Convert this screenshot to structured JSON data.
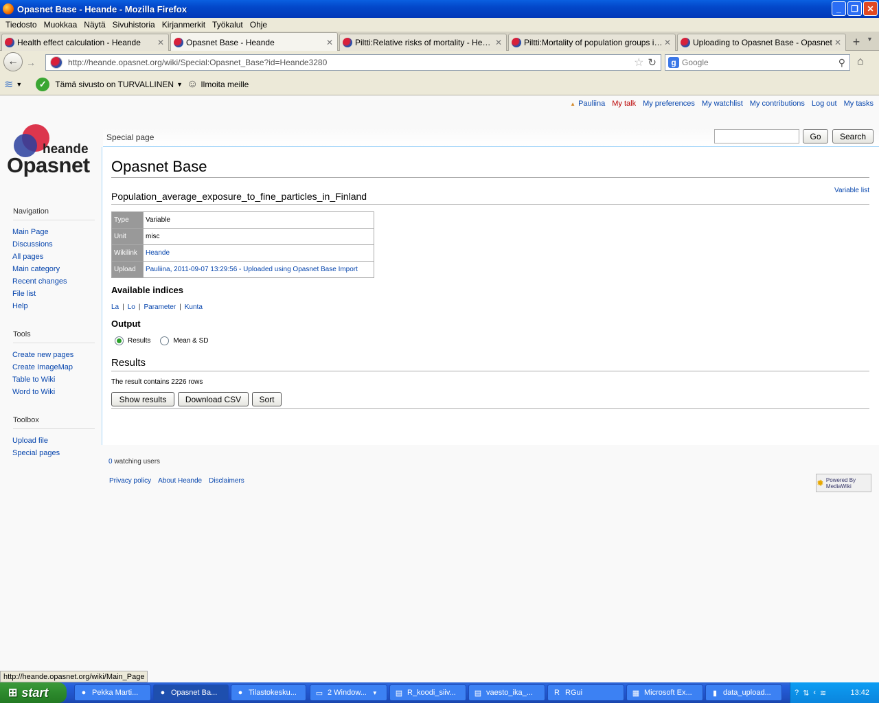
{
  "window": {
    "title": "Opasnet Base - Heande - Mozilla Firefox",
    "buttons": {
      "minimize": "_",
      "maximize": "❐",
      "close": "✕"
    }
  },
  "menubar": [
    "Tiedosto",
    "Muokkaa",
    "Näytä",
    "Sivuhistoria",
    "Kirjanmerkit",
    "Työkalut",
    "Ohje"
  ],
  "tabs": [
    {
      "label": "Health effect calculation - Heande",
      "active": false
    },
    {
      "label": "Opasnet Base - Heande",
      "active": true
    },
    {
      "label": "Piltti:Relative risks of mortality - Heande",
      "active": false
    },
    {
      "label": "Piltti:Mortality of population groups in Fi...",
      "active": false
    },
    {
      "label": "Uploading to Opasnet Base - Opasnet",
      "active": false
    }
  ],
  "navbar": {
    "url": "http://heande.opasnet.org/wiki/Special:Opasnet_Base?id=Heande3280",
    "search_placeholder": "Google"
  },
  "exttoolbar": {
    "safe_text": "Tämä sivusto on TURVALLINEN",
    "report_text": "Ilmoita meille"
  },
  "personal": {
    "user": "Pauliina",
    "talk": "My talk",
    "preferences": "My preferences",
    "watchlist": "My watchlist",
    "contributions": "My contributions",
    "logout": "Log out",
    "tasks": "My tasks"
  },
  "logo": {
    "top": "heande",
    "bottom": "Opasnet"
  },
  "sidebar": {
    "navigation": {
      "title": "Navigation",
      "items": [
        "Main Page",
        "Discussions",
        "All pages",
        "Main category",
        "Recent changes",
        "File list",
        "Help"
      ]
    },
    "tools": {
      "title": "Tools",
      "items": [
        "Create new pages",
        "Create ImageMap",
        "Table to Wiki",
        "Word to Wiki"
      ]
    },
    "toolbox": {
      "title": "Toolbox",
      "items": [
        "Upload file",
        "Special pages"
      ]
    }
  },
  "header": {
    "tab_label": "Special page",
    "go_label": "Go",
    "search_label": "Search"
  },
  "main": {
    "title": "Opasnet Base",
    "variable_list": "Variable list",
    "variable_name": "Population_average_exposure_to_fine_particles_in_Finland",
    "meta": [
      {
        "key": "Type",
        "value": "Variable"
      },
      {
        "key": "Unit",
        "value": "misc"
      },
      {
        "key": "Wikilink",
        "value": "Heande"
      },
      {
        "key": "Upload",
        "value": "Pauliina, 2011-09-07 13:29:56 - Uploaded using Opasnet Base Import"
      }
    ],
    "indices_title": "Available indices",
    "indices": [
      "La",
      "Lo",
      "Parameter",
      "Kunta"
    ],
    "output_title": "Output",
    "output_options": [
      {
        "label": "Results",
        "selected": true
      },
      {
        "label": "Mean & SD",
        "selected": false
      }
    ],
    "results_title": "Results",
    "rows_text": "The result contains 2226 rows",
    "buttons": {
      "show": "Show results",
      "download": "Download CSV",
      "sort": "Sort"
    }
  },
  "footer": {
    "watch_count": "0",
    "watch_text": " watching users",
    "links": [
      "Privacy policy",
      "About Heande",
      "Disclaimers"
    ],
    "powered": "Powered By MediaWiki"
  },
  "statusbar": "http://heande.opasnet.org/wiki/Main_Page",
  "taskbar": {
    "start": "start",
    "tasks": [
      {
        "label": "Pekka Marti...",
        "icon": "firefox-icon",
        "active": false
      },
      {
        "label": "Opasnet Ba...",
        "icon": "firefox-icon",
        "active": true
      },
      {
        "label": "Tilastokesku...",
        "icon": "firefox-icon",
        "active": false
      },
      {
        "label": "2 Window...",
        "icon": "folder-icon",
        "active": false
      },
      {
        "label": "R_koodi_siiv...",
        "icon": "document-icon",
        "active": false
      },
      {
        "label": "vaesto_ika_...",
        "icon": "document-icon",
        "active": false
      },
      {
        "label": "RGui",
        "icon": "r-icon",
        "active": false
      },
      {
        "label": "Microsoft Ex...",
        "icon": "excel-icon",
        "active": false
      },
      {
        "label": "data_upload...",
        "icon": "app-icon",
        "active": false
      }
    ],
    "clock": "13:42"
  }
}
